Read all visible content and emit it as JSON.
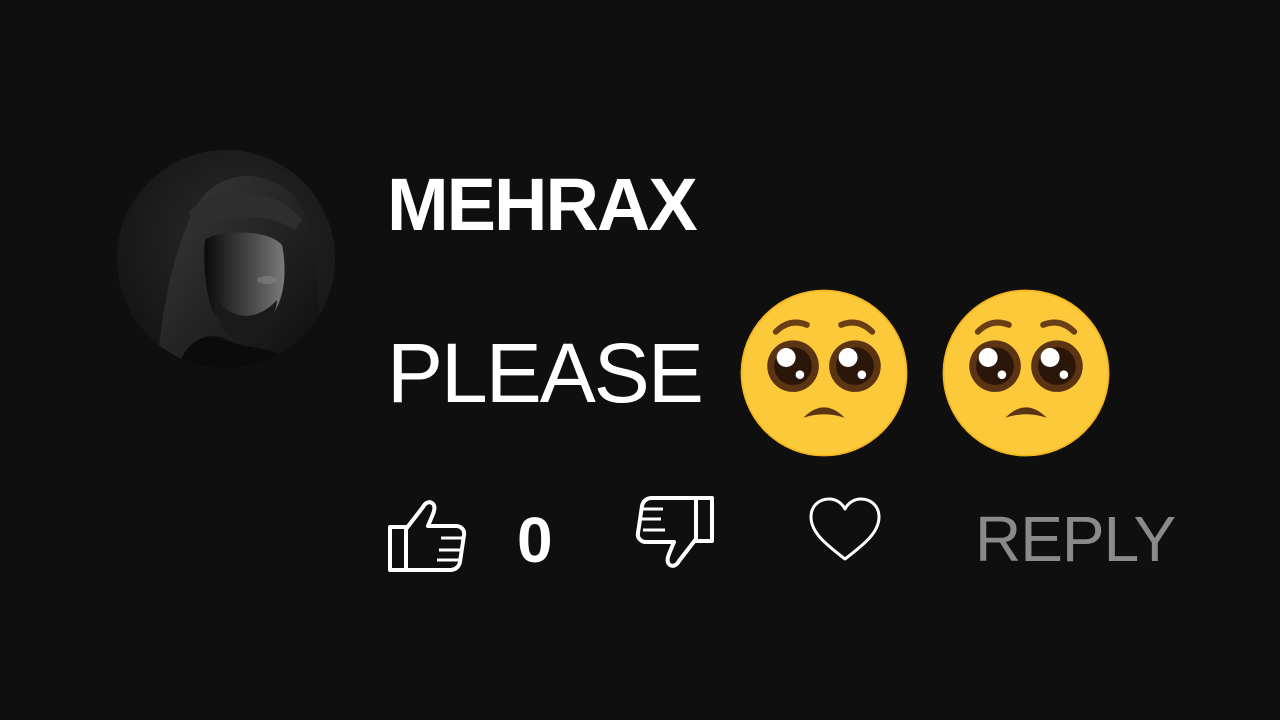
{
  "comment": {
    "author": "MEHRAX",
    "text": "PLEASE",
    "emojis": [
      "pleading-face",
      "pleading-face"
    ],
    "like_count": "0",
    "reply_label": "REPLY"
  },
  "icons": {
    "like": "thumbs-up-icon",
    "dislike": "thumbs-down-icon",
    "heart": "heart-icon"
  },
  "colors": {
    "background": "#0f0f0f",
    "text": "#ffffff",
    "reply": "#8a8a8a",
    "emoji": "#fbc93a"
  }
}
